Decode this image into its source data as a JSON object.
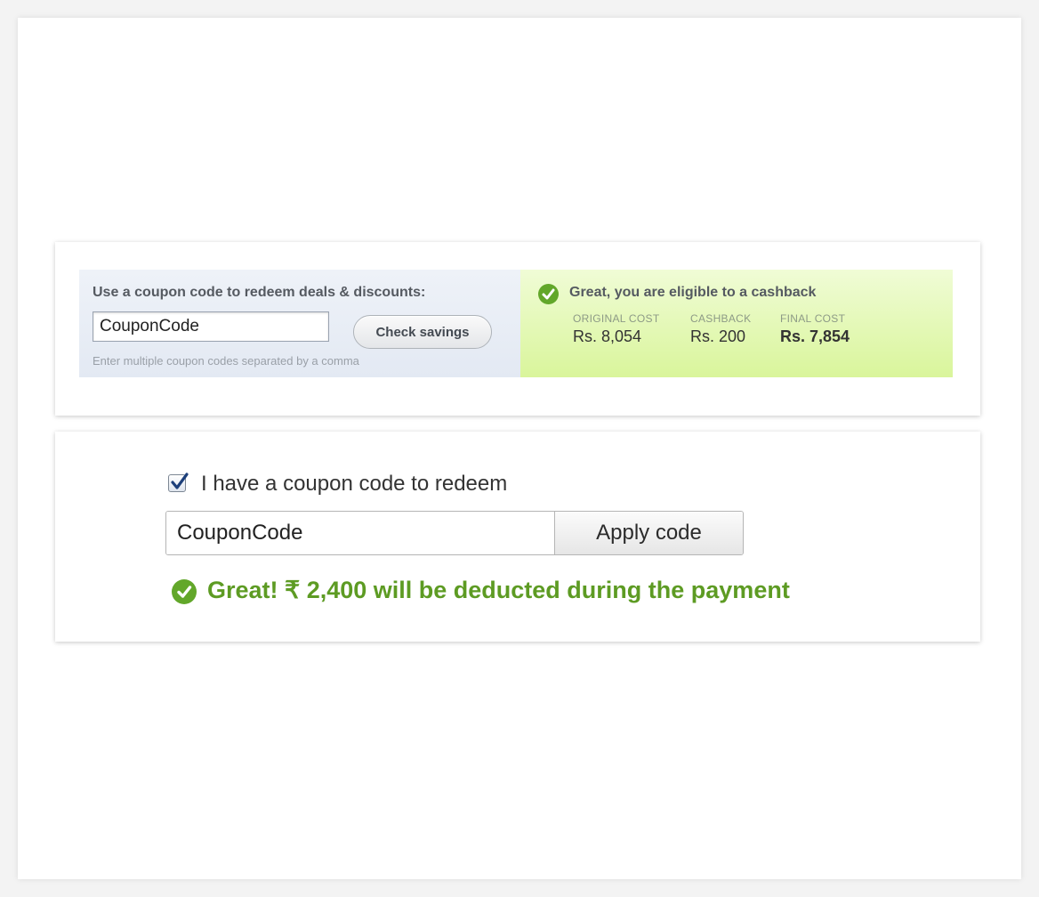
{
  "colors": {
    "success_green": "#5d9b23",
    "coupon_panel_bg": "#e3e9f3",
    "cashback_panel_bg": "#d9f59b"
  },
  "cashback_widget": {
    "heading": "Use a coupon code to redeem deals & discounts:",
    "coupon_input_value": "CouponCode",
    "check_button_label": "Check savings",
    "hint": "Enter multiple coupon codes separated by a comma",
    "result": {
      "icon": "check-circle-icon",
      "message": "Great, you are eligible to a cashback",
      "original_cost_label": "ORIGINAL COST",
      "original_cost_value": "Rs. 8,054",
      "cashback_label": "CASHBACK",
      "cashback_value": "Rs. 200",
      "final_cost_label": "FINAL COST",
      "final_cost_value": "Rs. 7,854"
    }
  },
  "redeem_widget": {
    "checkbox_checked": true,
    "checkbox_label": "I have a coupon code to redeem",
    "coupon_input_value": "CouponCode",
    "apply_button_label": "Apply code",
    "success_icon": "check-circle-icon",
    "success_message": "Great! ₹ 2,400 will be deducted during the payment"
  }
}
